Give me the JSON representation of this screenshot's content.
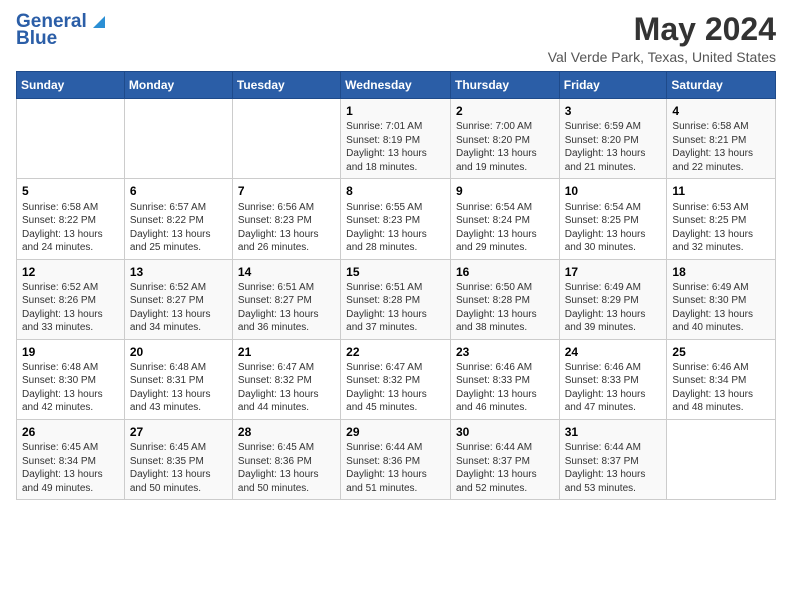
{
  "logo": {
    "line1": "General",
    "line2": "Blue"
  },
  "title": "May 2024",
  "subtitle": "Val Verde Park, Texas, United States",
  "days_of_week": [
    "Sunday",
    "Monday",
    "Tuesday",
    "Wednesday",
    "Thursday",
    "Friday",
    "Saturday"
  ],
  "weeks": [
    [
      {
        "day": "",
        "text": ""
      },
      {
        "day": "",
        "text": ""
      },
      {
        "day": "",
        "text": ""
      },
      {
        "day": "1",
        "text": "Sunrise: 7:01 AM\nSunset: 8:19 PM\nDaylight: 13 hours and 18 minutes."
      },
      {
        "day": "2",
        "text": "Sunrise: 7:00 AM\nSunset: 8:20 PM\nDaylight: 13 hours and 19 minutes."
      },
      {
        "day": "3",
        "text": "Sunrise: 6:59 AM\nSunset: 8:20 PM\nDaylight: 13 hours and 21 minutes."
      },
      {
        "day": "4",
        "text": "Sunrise: 6:58 AM\nSunset: 8:21 PM\nDaylight: 13 hours and 22 minutes."
      }
    ],
    [
      {
        "day": "5",
        "text": "Sunrise: 6:58 AM\nSunset: 8:22 PM\nDaylight: 13 hours and 24 minutes."
      },
      {
        "day": "6",
        "text": "Sunrise: 6:57 AM\nSunset: 8:22 PM\nDaylight: 13 hours and 25 minutes."
      },
      {
        "day": "7",
        "text": "Sunrise: 6:56 AM\nSunset: 8:23 PM\nDaylight: 13 hours and 26 minutes."
      },
      {
        "day": "8",
        "text": "Sunrise: 6:55 AM\nSunset: 8:23 PM\nDaylight: 13 hours and 28 minutes."
      },
      {
        "day": "9",
        "text": "Sunrise: 6:54 AM\nSunset: 8:24 PM\nDaylight: 13 hours and 29 minutes."
      },
      {
        "day": "10",
        "text": "Sunrise: 6:54 AM\nSunset: 8:25 PM\nDaylight: 13 hours and 30 minutes."
      },
      {
        "day": "11",
        "text": "Sunrise: 6:53 AM\nSunset: 8:25 PM\nDaylight: 13 hours and 32 minutes."
      }
    ],
    [
      {
        "day": "12",
        "text": "Sunrise: 6:52 AM\nSunset: 8:26 PM\nDaylight: 13 hours and 33 minutes."
      },
      {
        "day": "13",
        "text": "Sunrise: 6:52 AM\nSunset: 8:27 PM\nDaylight: 13 hours and 34 minutes."
      },
      {
        "day": "14",
        "text": "Sunrise: 6:51 AM\nSunset: 8:27 PM\nDaylight: 13 hours and 36 minutes."
      },
      {
        "day": "15",
        "text": "Sunrise: 6:51 AM\nSunset: 8:28 PM\nDaylight: 13 hours and 37 minutes."
      },
      {
        "day": "16",
        "text": "Sunrise: 6:50 AM\nSunset: 8:28 PM\nDaylight: 13 hours and 38 minutes."
      },
      {
        "day": "17",
        "text": "Sunrise: 6:49 AM\nSunset: 8:29 PM\nDaylight: 13 hours and 39 minutes."
      },
      {
        "day": "18",
        "text": "Sunrise: 6:49 AM\nSunset: 8:30 PM\nDaylight: 13 hours and 40 minutes."
      }
    ],
    [
      {
        "day": "19",
        "text": "Sunrise: 6:48 AM\nSunset: 8:30 PM\nDaylight: 13 hours and 42 minutes."
      },
      {
        "day": "20",
        "text": "Sunrise: 6:48 AM\nSunset: 8:31 PM\nDaylight: 13 hours and 43 minutes."
      },
      {
        "day": "21",
        "text": "Sunrise: 6:47 AM\nSunset: 8:32 PM\nDaylight: 13 hours and 44 minutes."
      },
      {
        "day": "22",
        "text": "Sunrise: 6:47 AM\nSunset: 8:32 PM\nDaylight: 13 hours and 45 minutes."
      },
      {
        "day": "23",
        "text": "Sunrise: 6:46 AM\nSunset: 8:33 PM\nDaylight: 13 hours and 46 minutes."
      },
      {
        "day": "24",
        "text": "Sunrise: 6:46 AM\nSunset: 8:33 PM\nDaylight: 13 hours and 47 minutes."
      },
      {
        "day": "25",
        "text": "Sunrise: 6:46 AM\nSunset: 8:34 PM\nDaylight: 13 hours and 48 minutes."
      }
    ],
    [
      {
        "day": "26",
        "text": "Sunrise: 6:45 AM\nSunset: 8:34 PM\nDaylight: 13 hours and 49 minutes."
      },
      {
        "day": "27",
        "text": "Sunrise: 6:45 AM\nSunset: 8:35 PM\nDaylight: 13 hours and 50 minutes."
      },
      {
        "day": "28",
        "text": "Sunrise: 6:45 AM\nSunset: 8:36 PM\nDaylight: 13 hours and 50 minutes."
      },
      {
        "day": "29",
        "text": "Sunrise: 6:44 AM\nSunset: 8:36 PM\nDaylight: 13 hours and 51 minutes."
      },
      {
        "day": "30",
        "text": "Sunrise: 6:44 AM\nSunset: 8:37 PM\nDaylight: 13 hours and 52 minutes."
      },
      {
        "day": "31",
        "text": "Sunrise: 6:44 AM\nSunset: 8:37 PM\nDaylight: 13 hours and 53 minutes."
      },
      {
        "day": "",
        "text": ""
      }
    ]
  ]
}
